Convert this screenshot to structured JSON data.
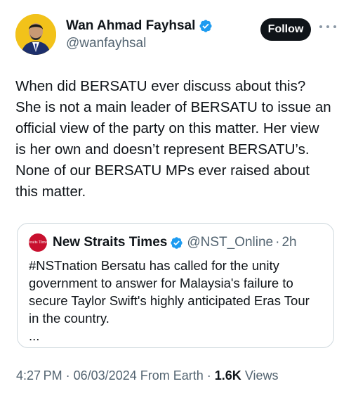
{
  "author": {
    "display_name": "Wan Ahmad Fayhsal",
    "handle": "@wanfayhsal",
    "verified": true,
    "follow_label": "Follow"
  },
  "tweet": {
    "lines": [
      "When did BERSATU ever discuss about this?",
      "She is not a main leader of BERSATU to issue an",
      "official view of the party on this matter. Her view",
      "is her own and doesn’t represent BERSATU’s.",
      "None of our BERSATU MPs ever raised about",
      "this matter."
    ]
  },
  "quoted": {
    "logo_text": "Straits Times",
    "display_name": "New Straits Times",
    "verified": true,
    "handle": "@NST_Online",
    "separator": "·",
    "time": "2h",
    "lines": [
      "#NSTnation Bersatu has called for the unity",
      "government to answer for Malaysia's failure to",
      "secure Taylor Swift's highly anticipated Eras Tour",
      "in the country.",
      "..."
    ]
  },
  "meta": {
    "time": "4:27 PM",
    "separator": " · ",
    "date": "06/03/2024",
    "source": "From Earth",
    "views_count": "1.6K",
    "views_label": "Views"
  },
  "colors": {
    "verified_blue": "#1d9bf0",
    "follow_bg": "#0f1419",
    "avatar_bg": "#f2c21a",
    "nst_red": "#c8102e"
  }
}
